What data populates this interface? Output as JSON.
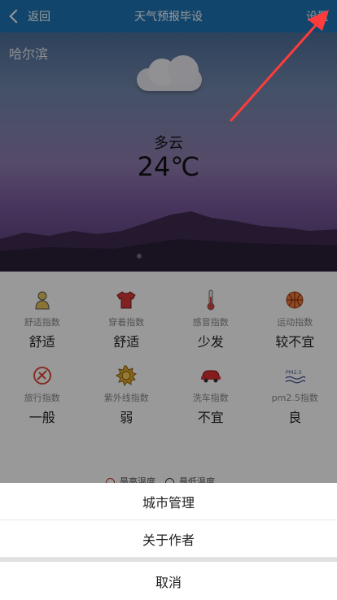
{
  "navbar": {
    "back_label": "返回",
    "title": "天气预报毕设",
    "settings_label": "设置"
  },
  "weather": {
    "city": "哈尔滨",
    "description": "多云",
    "temperature": "24℃"
  },
  "indices": [
    {
      "icon": "person-icon",
      "label": "舒适指数",
      "value": "舒适"
    },
    {
      "icon": "shirt-icon",
      "label": "穿着指数",
      "value": "舒适"
    },
    {
      "icon": "thermometer-icon",
      "label": "感冒指数",
      "value": "少发"
    },
    {
      "icon": "ball-icon",
      "label": "运动指数",
      "value": "较不宜"
    },
    {
      "icon": "travel-icon",
      "label": "旅行指数",
      "value": "一般"
    },
    {
      "icon": "sun-icon",
      "label": "紫外线指数",
      "value": "弱"
    },
    {
      "icon": "car-icon",
      "label": "洗车指数",
      "value": "不宜"
    },
    {
      "icon": "haze-icon",
      "label": "pm2.5指数",
      "value": "良"
    }
  ],
  "legend": {
    "items": [
      "最高温度",
      "最低温度"
    ]
  },
  "action_sheet": {
    "city_management": "城市管理",
    "about_author": "关于作者",
    "cancel": "取消"
  },
  "colors": {
    "navbar": "#1e73b4",
    "annotation_arrow": "#ff3b3b"
  }
}
